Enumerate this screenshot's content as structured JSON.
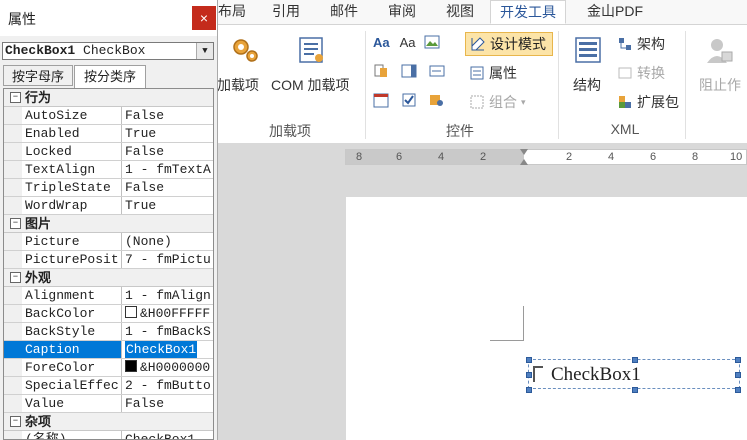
{
  "props_window": {
    "title": "属性",
    "close": "×",
    "object_name": "CheckBox1",
    "object_type": "CheckBox",
    "tabs": [
      "按字母序",
      "按分类序"
    ],
    "sections": [
      {
        "label": "行为",
        "rows": [
          {
            "key": "AutoSize",
            "value": "False"
          },
          {
            "key": "Enabled",
            "value": "True"
          },
          {
            "key": "Locked",
            "value": "False"
          },
          {
            "key": "TextAlign",
            "value": "1 - fmTextA"
          },
          {
            "key": "TripleState",
            "value": "False"
          },
          {
            "key": "WordWrap",
            "value": "True"
          }
        ]
      },
      {
        "label": "图片",
        "rows": [
          {
            "key": "Picture",
            "value": "(None)"
          },
          {
            "key": "PicturePosit",
            "value": "7 - fmPictu"
          }
        ]
      },
      {
        "label": "外观",
        "rows": [
          {
            "key": "Alignment",
            "value": "1 - fmAlign"
          },
          {
            "key": "BackColor",
            "value": "&H00FFFFF"
          },
          {
            "key": "BackStyle",
            "value": "1 - fmBackS"
          },
          {
            "key": "Caption",
            "value": "CheckBox1"
          },
          {
            "key": "ForeColor",
            "value": "&H0000000"
          },
          {
            "key": "SpecialEffec",
            "value": "2 - fmButto"
          },
          {
            "key": "Value",
            "value": "False"
          }
        ]
      },
      {
        "label": "杂项",
        "rows": [
          {
            "key": "(名称)",
            "value": "CheckBox1"
          }
        ]
      }
    ],
    "backcolor_swatch": "#ffffff",
    "forecolor_swatch": "#000000"
  },
  "ribbon": {
    "tabs": [
      "布局",
      "引用",
      "邮件",
      "审阅",
      "视图",
      "开发工具",
      "金山PDF"
    ],
    "active_tab": "开发工具",
    "addins_group": {
      "addins_label": "加载项",
      "com_label": "COM 加载项",
      "group_label": "加载项"
    },
    "controls_group": {
      "design_mode": "设计模式",
      "properties": "属性",
      "group": "组合",
      "group_label": "控件"
    },
    "xml_group": {
      "structure": "结构",
      "schema": "架构",
      "transform": "转换",
      "expansion": "扩展包",
      "group_label": "XML"
    },
    "protect_group": {
      "block_authors": "阻止作"
    }
  },
  "ruler": {
    "left_numbers": [
      "8",
      "6",
      "4",
      "2"
    ],
    "right_numbers": [
      "2",
      "4",
      "6",
      "8",
      "10"
    ]
  },
  "document": {
    "checkbox_caption": "CheckBox1"
  },
  "colors": {
    "accent": "#0078d7",
    "design_mode_bg": "#fce4a8",
    "close_red": "#c42b1c"
  }
}
